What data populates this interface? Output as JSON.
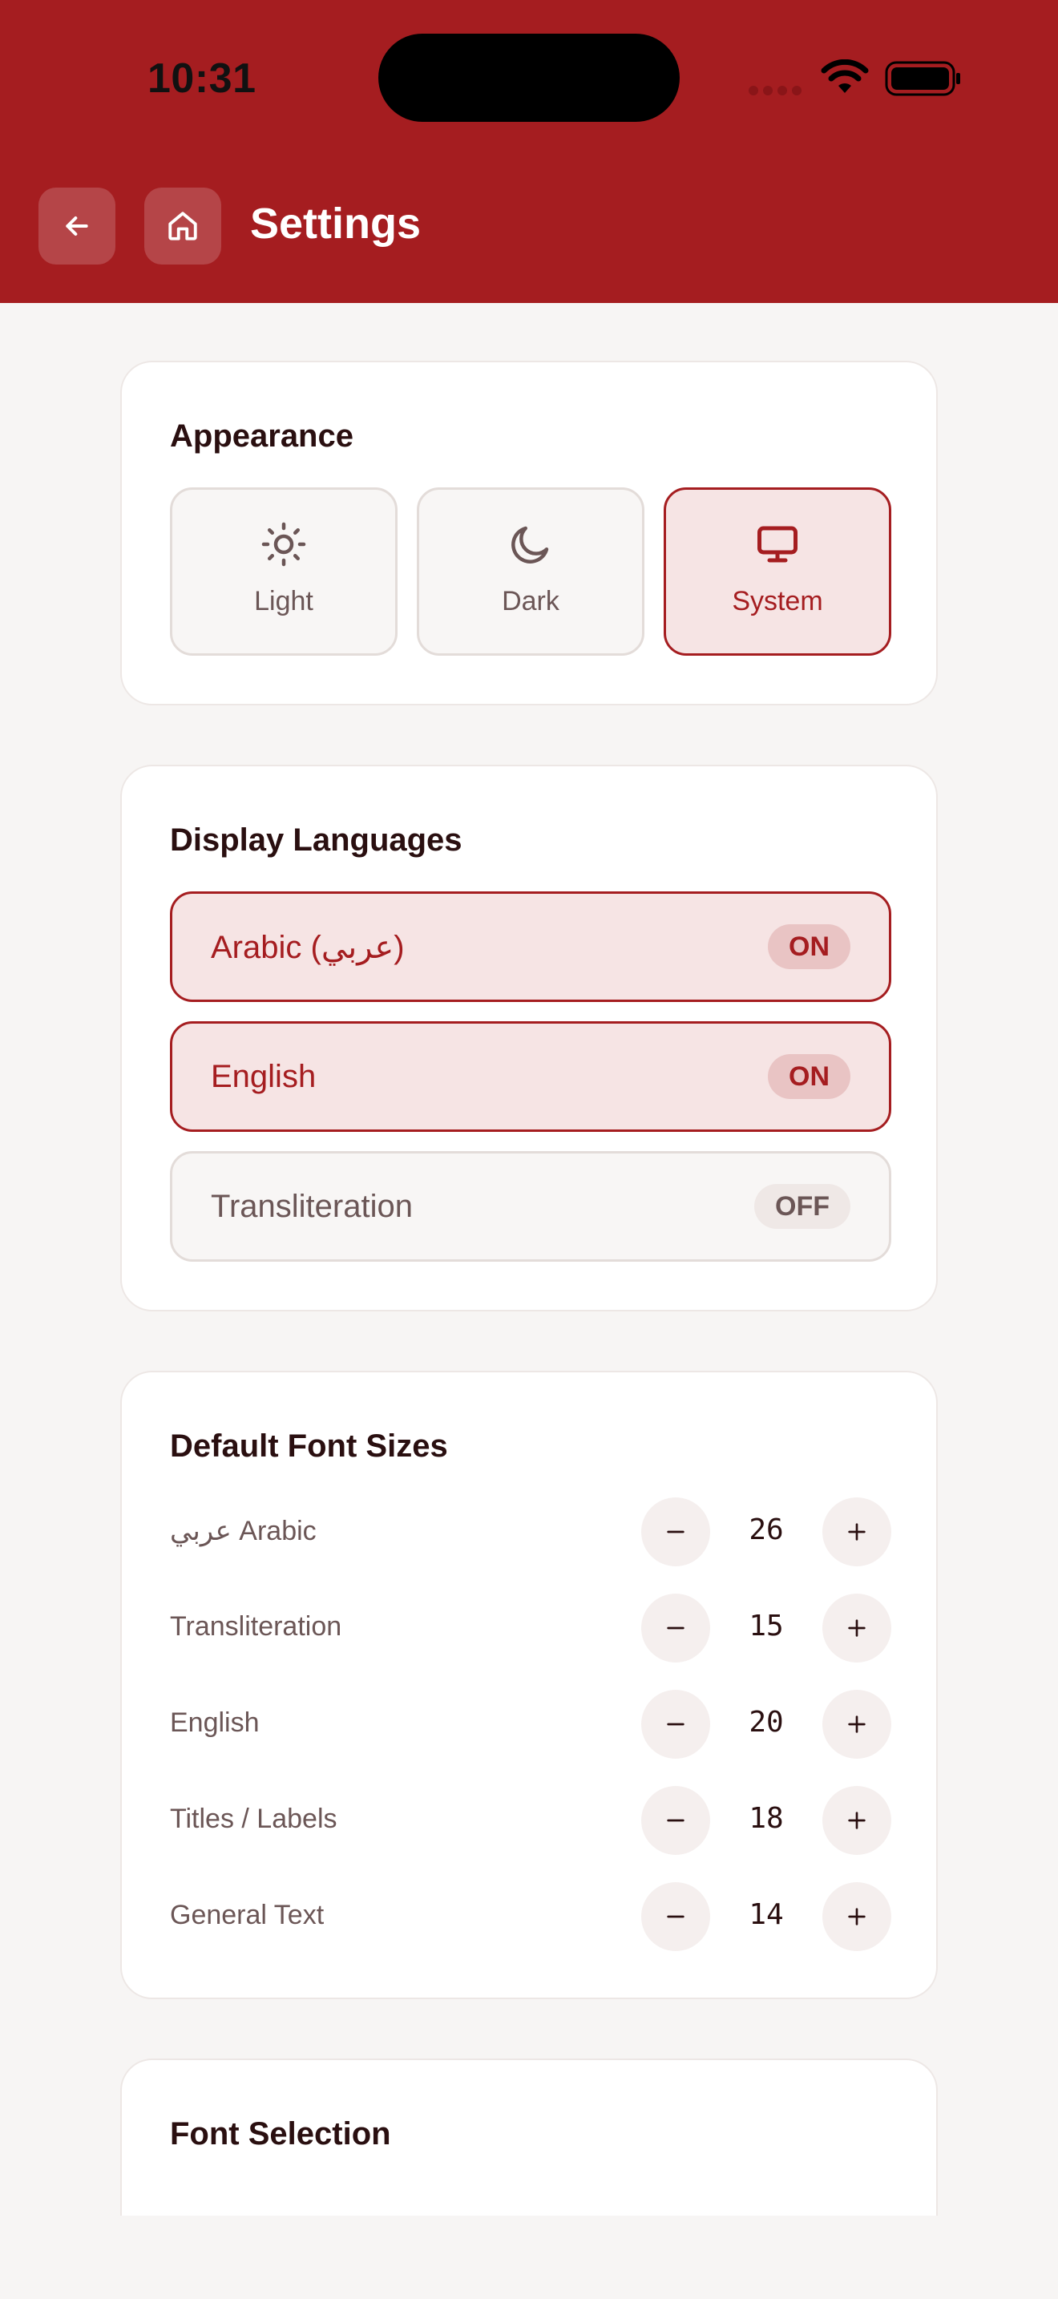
{
  "status_bar": {
    "time": "10:31"
  },
  "header": {
    "title": "Settings",
    "back_icon": "arrow-left-icon",
    "home_icon": "home-icon"
  },
  "colors": {
    "brand": "#a51d20",
    "selected_bg": "#f6e4e4",
    "background": "#f7f5f4"
  },
  "appearance": {
    "title": "Appearance",
    "options": [
      {
        "label": "Light",
        "icon": "sun-icon",
        "selected": false
      },
      {
        "label": "Dark",
        "icon": "moon-icon",
        "selected": false
      },
      {
        "label": "System",
        "icon": "monitor-icon",
        "selected": true
      }
    ]
  },
  "languages": {
    "title": "Display Languages",
    "items": [
      {
        "label": "Arabic (عربي)",
        "state": "ON"
      },
      {
        "label": "English",
        "state": "ON"
      },
      {
        "label": "Transliteration",
        "state": "OFF"
      }
    ]
  },
  "font_sizes": {
    "title": "Default Font Sizes",
    "items": [
      {
        "label": "عربي Arabic",
        "value": "26"
      },
      {
        "label": "Transliteration",
        "value": "15"
      },
      {
        "label": "English",
        "value": "20"
      },
      {
        "label": "Titles / Labels",
        "value": "18"
      },
      {
        "label": "General Text",
        "value": "14"
      }
    ]
  },
  "font_selection": {
    "title": "Font Selection"
  }
}
